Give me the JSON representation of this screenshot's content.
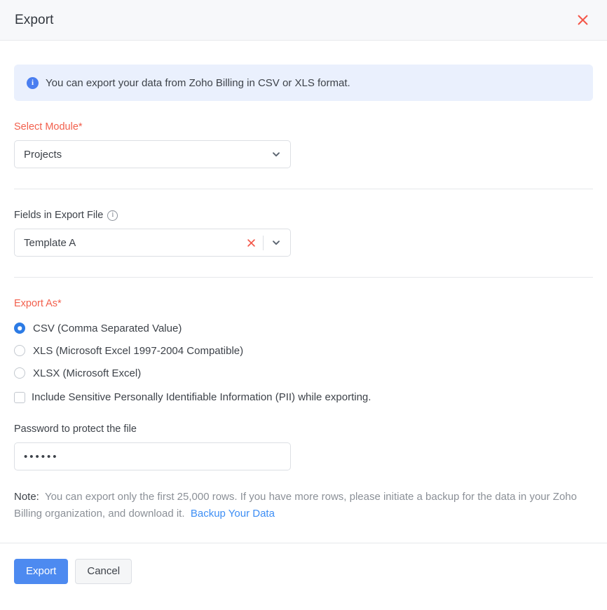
{
  "header": {
    "title": "Export",
    "close_icon": "close-icon"
  },
  "banner": {
    "icon": "info-circle-filled-icon",
    "icon_glyph": "i",
    "text": "You can export your data from Zoho Billing in CSV or XLS format.",
    "background_color": "#eaf0fd",
    "icon_color": "#4a7ef0"
  },
  "select_module": {
    "label": "Select Module*",
    "label_color": "#f2604d",
    "value": "Projects",
    "chevron_icon": "chevron-down-icon"
  },
  "fields_in_export": {
    "label": "Fields in Export File",
    "info_icon": "info-circle-outline-icon",
    "info_glyph": "i",
    "value": "Template A",
    "clear_icon": "clear-x-icon",
    "chevron_icon": "chevron-down-icon"
  },
  "export_as": {
    "label": "Export As*",
    "label_color": "#f2604d",
    "selected": "CSV (Comma Separated Value)",
    "accent_color": "#2c7be5",
    "options": [
      {
        "label": "CSV (Comma Separated Value)",
        "selected": true
      },
      {
        "label": "XLS (Microsoft Excel 1997-2004 Compatible)",
        "selected": false
      },
      {
        "label": "XLSX (Microsoft Excel)",
        "selected": false
      }
    ]
  },
  "pii_checkbox": {
    "label": "Include Sensitive Personally Identifiable Information (PII) while exporting.",
    "checked": false
  },
  "password": {
    "label": "Password to protect the file",
    "value": "••••••",
    "placeholder": ""
  },
  "note": {
    "prefix": "Note:",
    "text": "You can export only the first 25,000 rows. If you have more rows, please initiate a backup for the data in your Zoho Billing organization, and download it.",
    "link_label": "Backup Your Data",
    "link_color": "#3d8ef5"
  },
  "footer": {
    "primary_label": "Export",
    "primary_color": "#4d8af0",
    "secondary_label": "Cancel"
  }
}
